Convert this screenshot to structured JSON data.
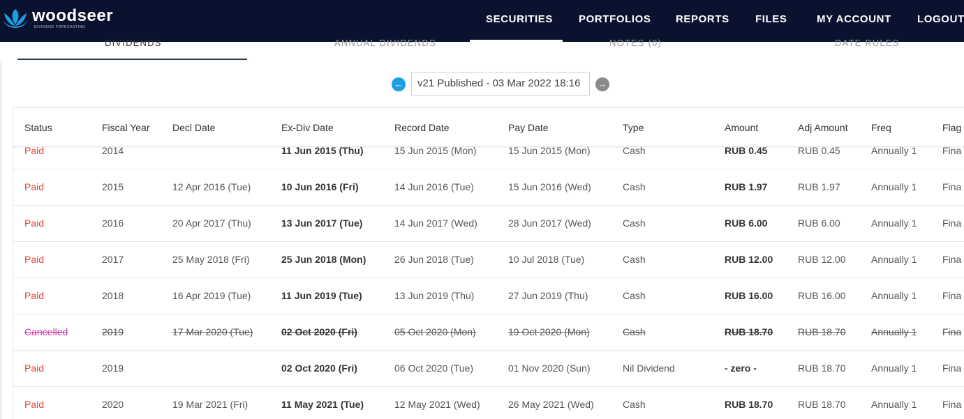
{
  "nav": {
    "logo_word": "woodseer",
    "logo_tagline": "DIVIDEND FORECASTING",
    "items": [
      "SECURITIES",
      "PORTFOLIOS",
      "REPORTS",
      "FILES",
      "MY ACCOUNT",
      "LOGOUT"
    ],
    "active": "SECURITIES"
  },
  "subtabs": [
    "DIVIDENDS",
    "ANNUAL DIVIDENDS",
    "NOTES (0)",
    "DATE RULES"
  ],
  "version": {
    "label": "v21 Published - 03 Mar 2022 18:16",
    "prev_icon": "arrow-left-icon",
    "next_icon": "arrow-right-icon"
  },
  "table": {
    "headers": [
      "Status",
      "Fiscal Year",
      "Decl Date",
      "Ex-Div Date",
      "Record Date",
      "Pay Date",
      "Type",
      "Amount",
      "Adj Amount",
      "Freq",
      "Flag"
    ],
    "rows": [
      [
        "Paid",
        "2014",
        "",
        "11 Jun 2015 (Thu)",
        "15 Jun 2015 (Mon)",
        "15 Jun 2015 (Mon)",
        "Cash",
        "RUB 0.45",
        "RUB 0.45",
        "Annually 1",
        "Fina"
      ],
      [
        "Paid",
        "2015",
        "12 Apr 2016 (Tue)",
        "10 Jun 2016 (Fri)",
        "14 Jun 2016 (Tue)",
        "15 Jun 2016 (Wed)",
        "Cash",
        "RUB 1.97",
        "RUB 1.97",
        "Annually 1",
        "Fina"
      ],
      [
        "Paid",
        "2016",
        "20 Apr 2017 (Thu)",
        "13 Jun 2017 (Tue)",
        "14 Jun 2017 (Wed)",
        "28 Jun 2017 (Wed)",
        "Cash",
        "RUB 6.00",
        "RUB 6.00",
        "Annually 1",
        "Fina"
      ],
      [
        "Paid",
        "2017",
        "25 May 2018 (Fri)",
        "25 Jun 2018 (Mon)",
        "26 Jun 2018 (Tue)",
        "10 Jul 2018 (Tue)",
        "Cash",
        "RUB 12.00",
        "RUB 12.00",
        "Annually 1",
        "Fina"
      ],
      [
        "Paid",
        "2018",
        "16 Apr 2019 (Tue)",
        "11 Jun 2019 (Tue)",
        "13 Jun 2019 (Thu)",
        "27 Jun 2019 (Thu)",
        "Cash",
        "RUB 16.00",
        "RUB 16.00",
        "Annually 1",
        "Fina"
      ],
      [
        "Cancelled",
        "2019",
        "17 Mar 2020 (Tue)",
        "02 Oct 2020 (Fri)",
        "05 Oct 2020 (Mon)",
        "19 Oct 2020 (Mon)",
        "Cash",
        "RUB 18.70",
        "RUB 18.70",
        "Annually 1",
        "Fina"
      ],
      [
        "Paid",
        "2019",
        "",
        "02 Oct 2020 (Fri)",
        "06 Oct 2020 (Tue)",
        "01 Nov 2020 (Sun)",
        "Nil Dividend",
        "- zero -",
        "RUB 18.70",
        "Annually 1",
        "Fina"
      ],
      [
        "Paid",
        "2020",
        "19 Mar 2021 (Fri)",
        "11 May 2021 (Tue)",
        "12 May 2021 (Wed)",
        "26 May 2021 (Wed)",
        "Cash",
        "RUB 18.70",
        "RUB 18.70",
        "Annually 1",
        "Fina"
      ]
    ]
  },
  "colors": {
    "nav_bg": "#0b1230",
    "logo_blue": "#1a9fe0",
    "status_paid": "#e0453b",
    "status_cancelled": "#c43ca8"
  }
}
